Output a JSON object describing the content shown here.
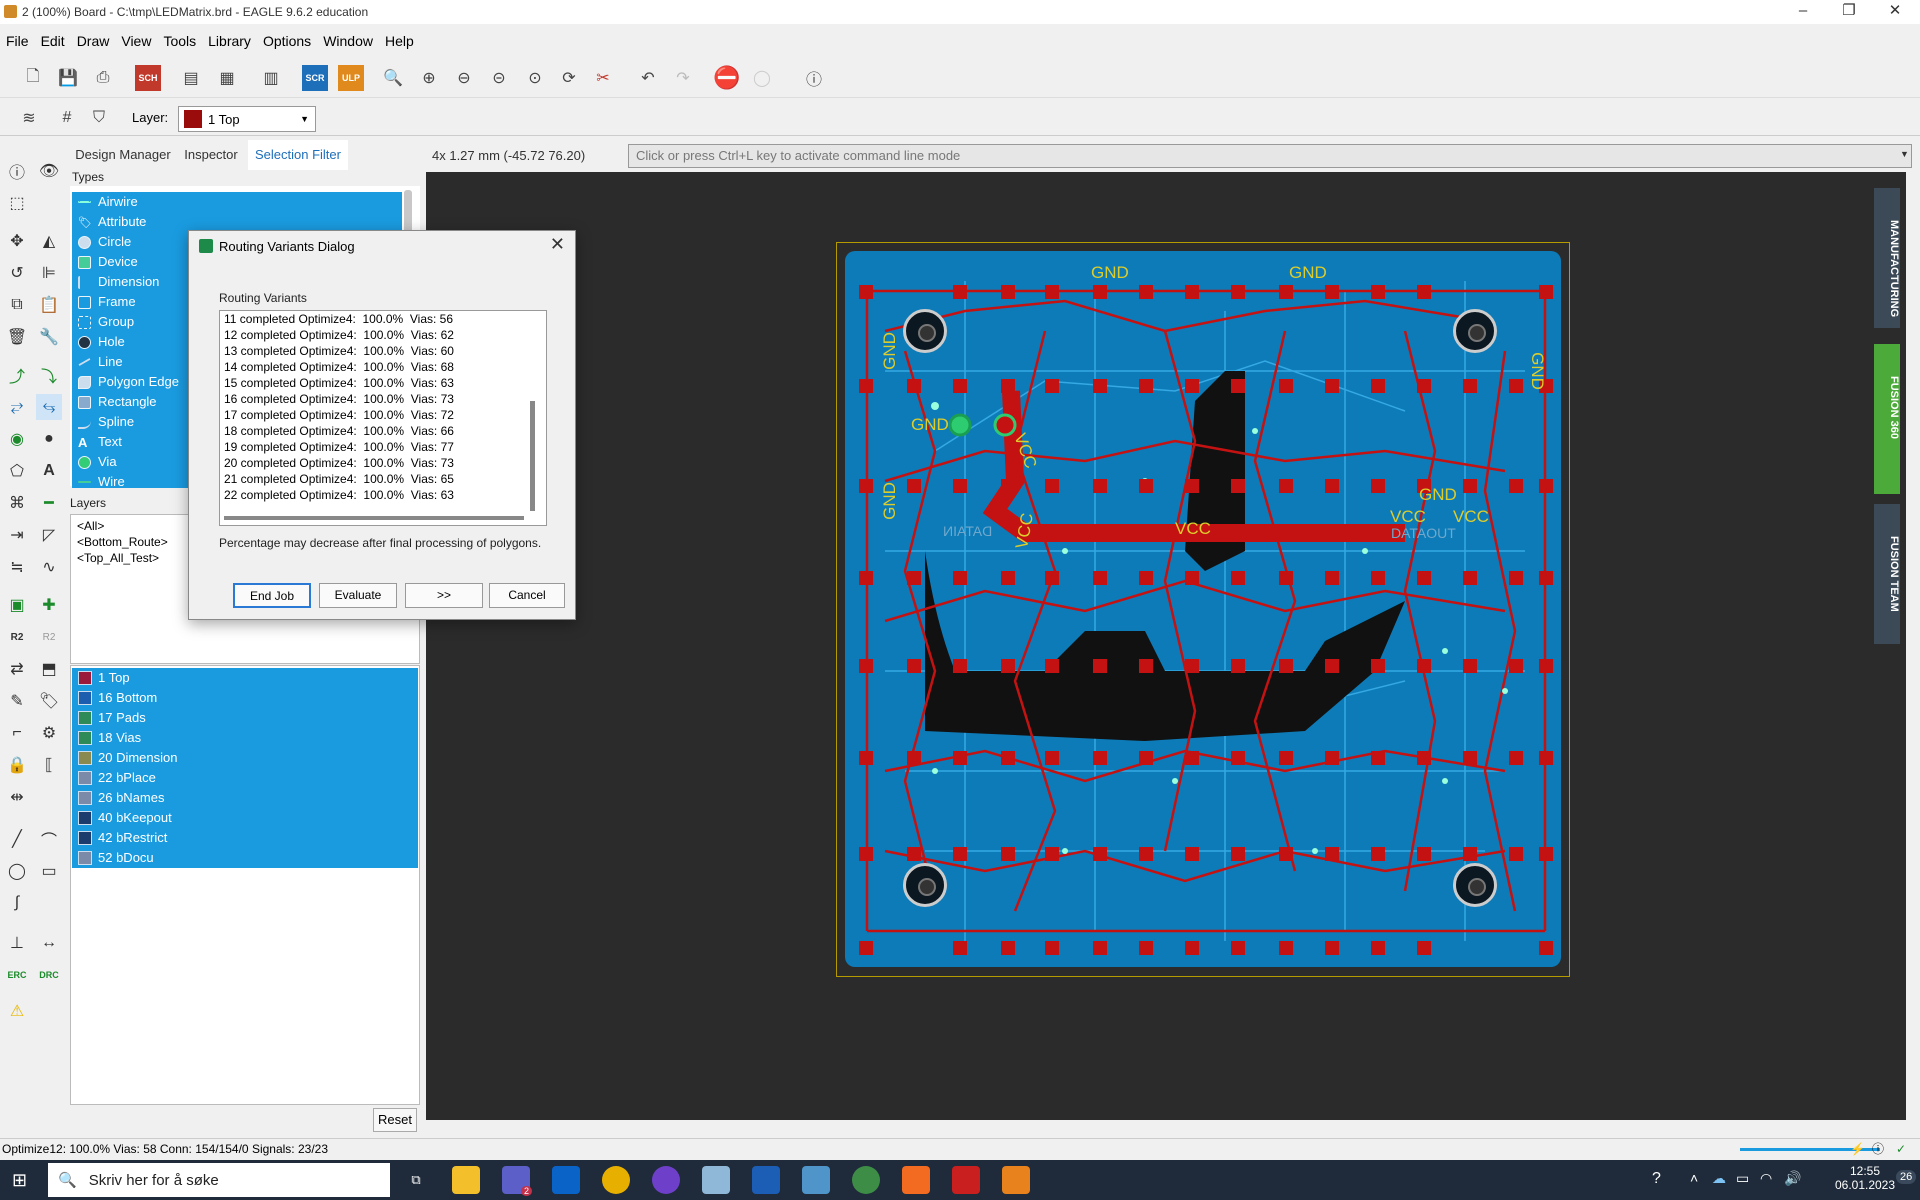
{
  "window": {
    "title": "2 (100%) Board - C:\\tmp\\LEDMatrix.brd - EAGLE 9.6.2 education"
  },
  "menu": [
    "File",
    "Edit",
    "Draw",
    "View",
    "Tools",
    "Library",
    "Options",
    "Window",
    "Help"
  ],
  "toolbar": {
    "scr_label": "SCR",
    "ulp_label": "ULP",
    "sch_label": "SCH"
  },
  "layer_bar": {
    "label": "Layer:",
    "selected": "1 Top"
  },
  "panel": {
    "tabs": [
      "Design Manager",
      "Inspector",
      "Selection Filter"
    ],
    "types_header": "Types",
    "types": [
      "Airwire",
      "Attribute",
      "Circle",
      "Device",
      "Dimension",
      "Frame",
      "Group",
      "Hole",
      "Line",
      "Polygon Edge",
      "Rectangle",
      "Spline",
      "Text",
      "Via",
      "Wire"
    ],
    "layers_header": "Layers",
    "layer_groups": [
      "<All>",
      "<Bottom_Route>",
      "<Top_All_Test>"
    ],
    "layers": [
      {
        "name": "1 Top",
        "color": "#9a1a3c"
      },
      {
        "name": "16 Bottom",
        "color": "#1d5fae"
      },
      {
        "name": "17 Pads",
        "color": "#2e8b57"
      },
      {
        "name": "18 Vias",
        "color": "#2e8b57"
      },
      {
        "name": "20 Dimension",
        "color": "#8a8a50"
      },
      {
        "name": "22 bPlace",
        "color": "#7a8aa8"
      },
      {
        "name": "26 bNames",
        "color": "#7a8aa8"
      },
      {
        "name": "40 bKeepout",
        "color": "#1d3c6e"
      },
      {
        "name": "42 bRestrict",
        "color": "#1d3c6e"
      },
      {
        "name": "52 bDocu",
        "color": "#7a8aa8"
      }
    ],
    "reset_label": "Reset"
  },
  "canvas": {
    "coordinates": "4x 1.27 mm (-45.72 76.20)",
    "command_placeholder": "Click or press Ctrl+L key to activate command line mode",
    "labels": [
      "GND",
      "GND",
      "GND",
      "GND",
      "GND",
      "GND",
      "VCC",
      "VCC",
      "VCC",
      "VCC",
      "VCC",
      "GND",
      "DATAOUT",
      "DATAIN"
    ]
  },
  "right_dock": [
    "MANUFACTURING",
    "FUSION 360",
    "FUSION TEAM"
  ],
  "dialog": {
    "title": "Routing Variants Dialog",
    "list_label": "Routing Variants",
    "variants": [
      "11 completed Optimize4:  100.0%  Vias: 56",
      "12 completed Optimize4:  100.0%  Vias: 62",
      "13 completed Optimize4:  100.0%  Vias: 60",
      "14 completed Optimize4:  100.0%  Vias: 68",
      "15 completed Optimize4:  100.0%  Vias: 63",
      "16 completed Optimize4:  100.0%  Vias: 73",
      "17 completed Optimize4:  100.0%  Vias: 72",
      "18 completed Optimize4:  100.0%  Vias: 66",
      "19 completed Optimize4:  100.0%  Vias: 77",
      "20 completed Optimize4:  100.0%  Vias: 73",
      "21 completed Optimize4:  100.0%  Vias: 65",
      "22 completed Optimize4:  100.0%  Vias: 63"
    ],
    "note": "Percentage may decrease after final processing of polygons.",
    "buttons": {
      "end_job": "End Job",
      "evaluate": "Evaluate",
      "next": ">>",
      "cancel": "Cancel"
    }
  },
  "status": "Optimize12: 100.0%  Vias: 58  Conn: 154/154/0  Signals: 23/23",
  "taskbar": {
    "search_placeholder": "Skriv her for å søke",
    "time": "12:55",
    "date": "06.01.2023",
    "notification_count": "26",
    "teams_badge": "2"
  }
}
